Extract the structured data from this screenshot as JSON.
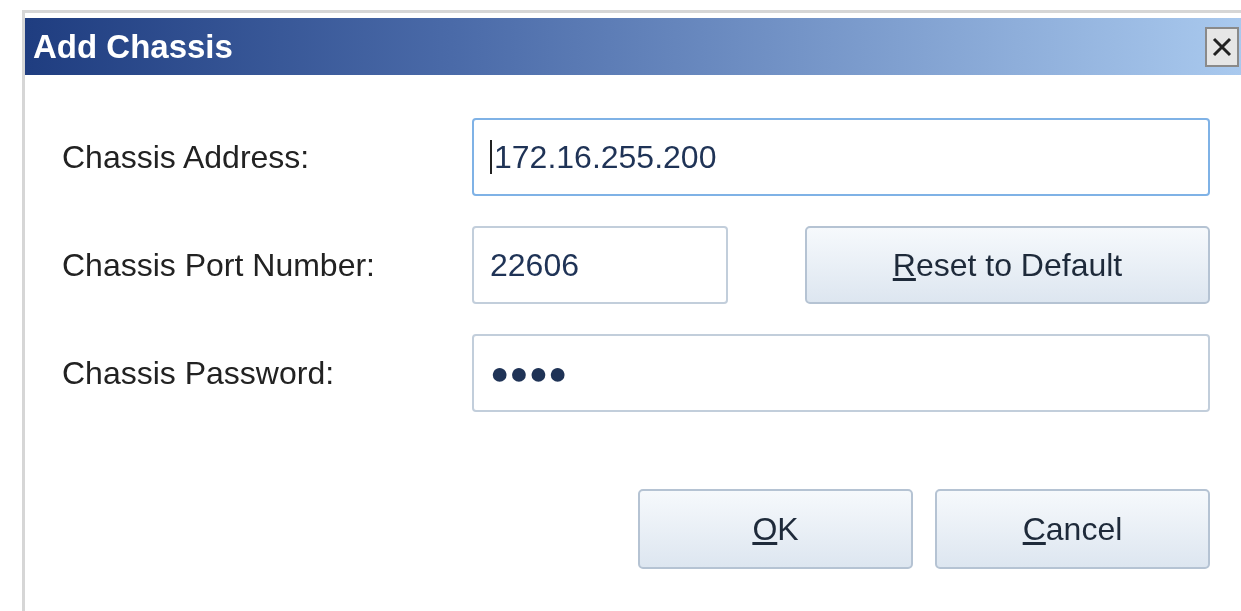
{
  "window": {
    "title": "Add Chassis"
  },
  "fields": [
    {
      "label": "Chassis Address:",
      "value": "172.16.255.200",
      "focused": true,
      "kind": "wide"
    },
    {
      "label": "Chassis Port Number:",
      "value": "22606",
      "focused": false,
      "kind": "narrow",
      "button": {
        "label": "Reset to Default",
        "first_letter_underlined": true
      }
    },
    {
      "label": "Chassis Password:",
      "value": "●●●●",
      "focused": false,
      "kind": "wide"
    }
  ],
  "buttons": [
    {
      "label": "OK",
      "first_letter_underlined": true
    },
    {
      "label": "Cancel",
      "first_letter_underlined": true
    }
  ]
}
